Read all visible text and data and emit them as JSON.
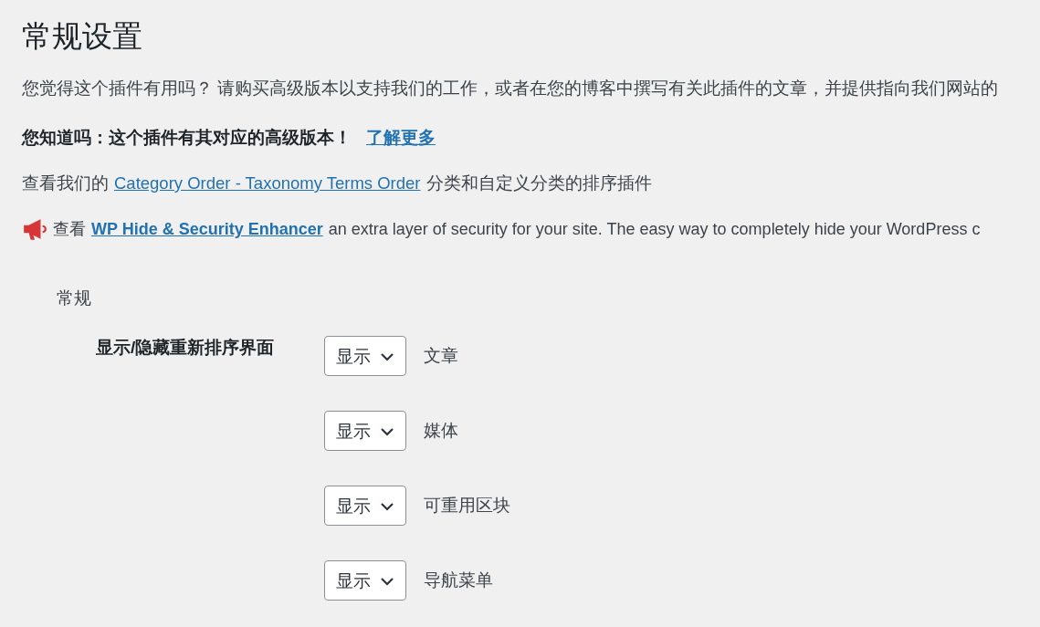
{
  "title": "常规设置",
  "intro": "您觉得这个插件有用吗？ 请购买高级版本以支持我们的工作，或者在您的博客中撰写有关此插件的文章，并提供指向我们网站的",
  "premium_notice": {
    "text": "您知道吗：这个插件有其对应的高级版本！",
    "link": "了解更多"
  },
  "related_plugin": {
    "before": "查看我们的",
    "link": "Category Order - Taxonomy Terms Order",
    "after": "分类和自定义分类的排序插件"
  },
  "promo": {
    "before": "查看",
    "link": "WP Hide & Security Enhancer",
    "after": "an extra layer of security for your site. The easy way to completely hide your WordPress c"
  },
  "section": {
    "title": "常规",
    "field_label": "显示/隐藏重新排序界面",
    "rows": [
      {
        "value": "显示",
        "label": "文章"
      },
      {
        "value": "显示",
        "label": "媒体"
      },
      {
        "value": "显示",
        "label": "可重用区块"
      },
      {
        "value": "显示",
        "label": "导航菜单"
      }
    ]
  }
}
